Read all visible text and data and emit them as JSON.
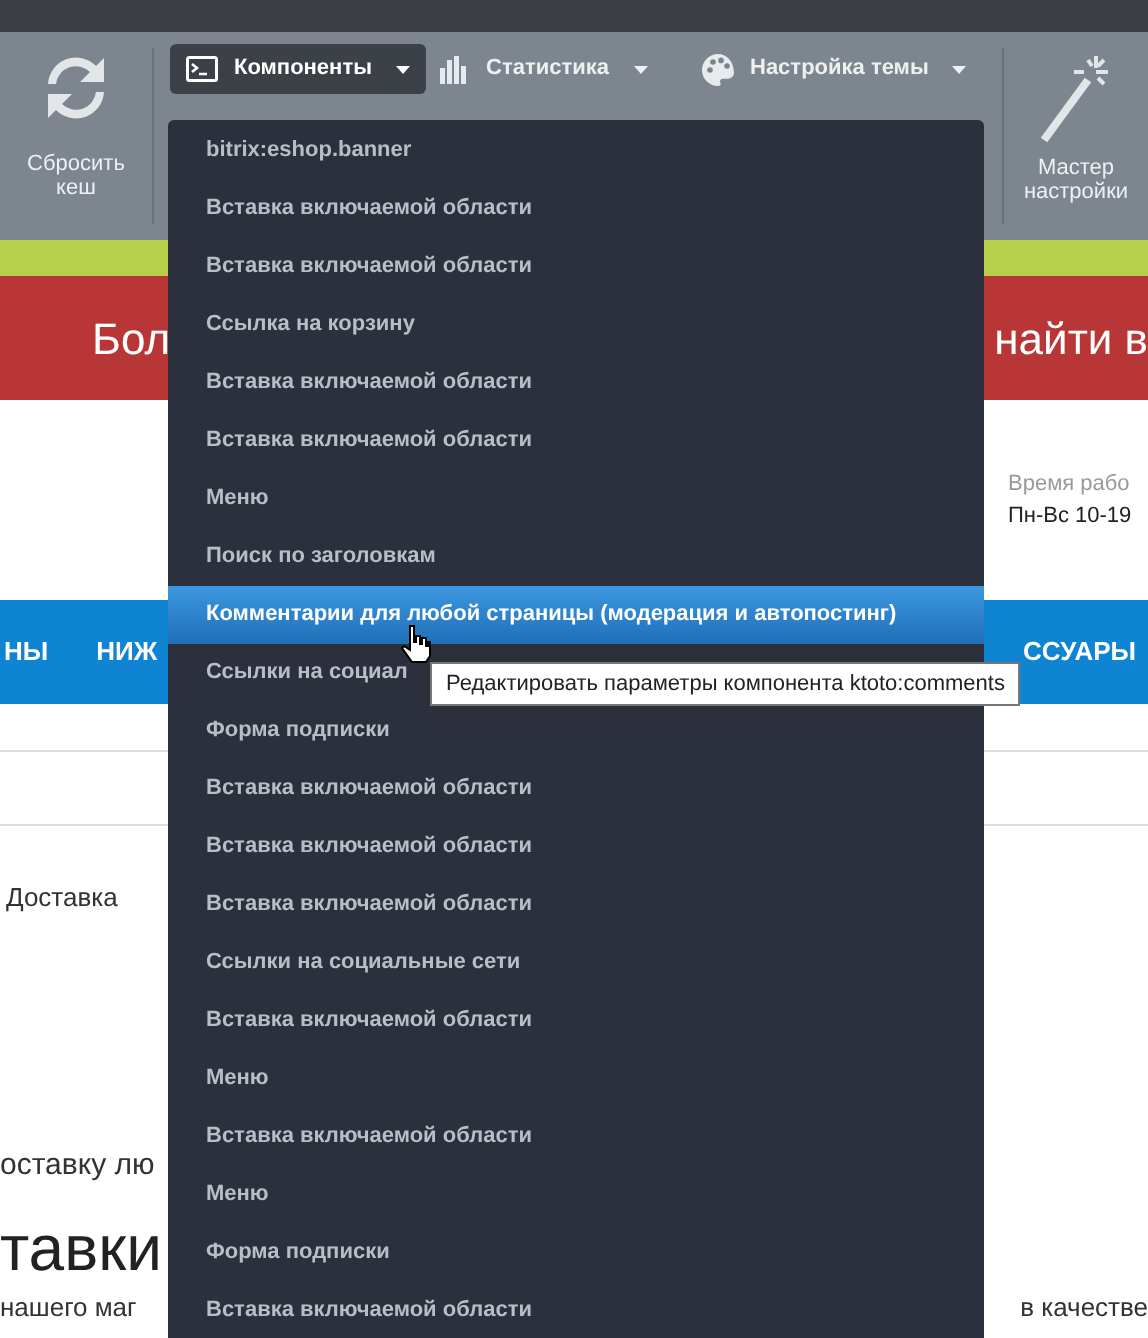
{
  "toolbar": {
    "cache_button": {
      "label": "Сбросить\nкеш"
    },
    "groups": [
      {
        "label": "Компоненты",
        "selected": true
      },
      {
        "label": "Статистика",
        "selected": false
      },
      {
        "label": "Настройка темы",
        "selected": false
      }
    ],
    "wizard_button": {
      "label": "Мастер\nнастройки"
    }
  },
  "banner": {
    "left": "Бол",
    "right": "найти в"
  },
  "header": {
    "hours_label": "Время рабо",
    "hours": "Пн-Вс 10-19"
  },
  "nav": {
    "left": [
      "НЫ",
      "НИЖ"
    ],
    "right": "ССУАРЫ"
  },
  "content": {
    "breadcrumb": "Доставка",
    "paragraph": "оставку лю",
    "heading": "тавки",
    "footer_left": "нашего маг",
    "footer_right": "в качестве"
  },
  "menu": {
    "items": [
      {
        "label": "bitrix:eshop.banner",
        "selected": false
      },
      {
        "label": "Вставка включаемой области",
        "selected": false
      },
      {
        "label": "Вставка включаемой области",
        "selected": false
      },
      {
        "label": "Ссылка на корзину",
        "selected": false
      },
      {
        "label": "Вставка включаемой области",
        "selected": false
      },
      {
        "label": "Вставка включаемой области",
        "selected": false
      },
      {
        "label": "Меню",
        "selected": false
      },
      {
        "label": "Поиск по заголовкам",
        "selected": false
      },
      {
        "label": "Комментарии для любой страницы (модерация и автопостинг)",
        "selected": true
      },
      {
        "label": "Ссылки на социал",
        "selected": false
      },
      {
        "label": "Форма подписки",
        "selected": false
      },
      {
        "label": "Вставка включаемой области",
        "selected": false
      },
      {
        "label": "Вставка включаемой области",
        "selected": false
      },
      {
        "label": "Вставка включаемой области",
        "selected": false
      },
      {
        "label": "Ссылки на социальные сети",
        "selected": false
      },
      {
        "label": "Вставка включаемой области",
        "selected": false
      },
      {
        "label": "Меню",
        "selected": false
      },
      {
        "label": "Вставка включаемой области",
        "selected": false
      },
      {
        "label": "Меню",
        "selected": false
      },
      {
        "label": "Форма подписки",
        "selected": false
      },
      {
        "label": "Вставка включаемой области",
        "selected": false
      }
    ]
  },
  "tooltip": "Редактировать параметры компонента ktoto:comments"
}
